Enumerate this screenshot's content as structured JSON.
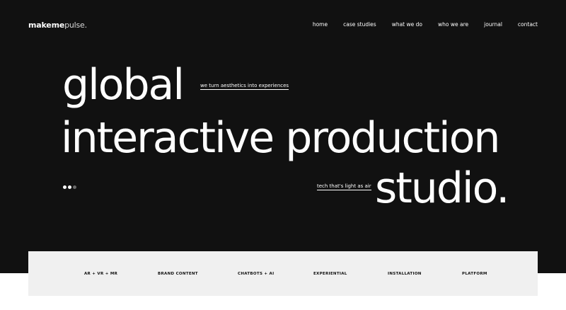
{
  "logo": {
    "bold": "makeme",
    "light": "pulse."
  },
  "nav": {
    "items": [
      "home",
      "case studies",
      "what we do",
      "who we are",
      "journal",
      "contact"
    ]
  },
  "hero": {
    "headline": [
      "global",
      "interactive production",
      "studio."
    ],
    "tagline_1": "we turn aesthetics into experiences",
    "tagline_2": "tech that's light as air"
  },
  "slider": {
    "total": 3,
    "active_index": 0
  },
  "services": {
    "items": [
      "AR + VR + MR",
      "BRAND CONTENT",
      "CHATBOTS + AI",
      "EXPERIENTIAL",
      "INSTALLATION",
      "PLATFORM"
    ]
  },
  "colors": {
    "hero_background": "#111111",
    "services_background": "#f0f0f0",
    "text_light": "#ffffff",
    "text_dark": "#111111"
  }
}
